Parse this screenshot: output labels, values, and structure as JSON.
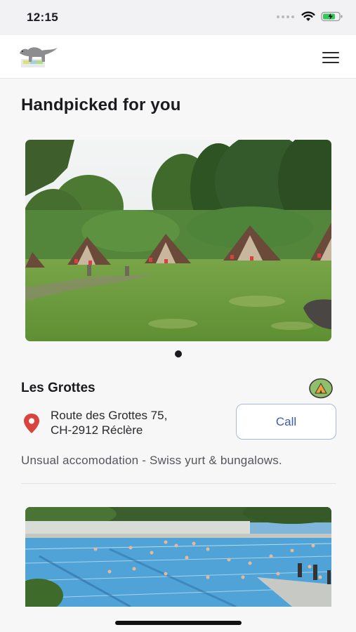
{
  "status_bar": {
    "time": "12:15"
  },
  "header": {
    "logo_icon": "dinosaur-logo-icon",
    "menu_icon": "hamburger-menu-icon"
  },
  "section": {
    "title": "Handpicked for you"
  },
  "featured": {
    "name": "Les Grottes",
    "category_icon": "tent-icon",
    "address_line1": "Route des Grottes 75,",
    "address_line2": "CH-2912 Réclère",
    "call_label": "Call",
    "description": "Unsual accomodation - Swiss yurt & bungalows.",
    "carousel_pages": 1,
    "carousel_active": 1
  },
  "colors": {
    "accent": "#3b5ea8",
    "pin": "#d9443c",
    "badge_bg": "#8fbf6a"
  }
}
